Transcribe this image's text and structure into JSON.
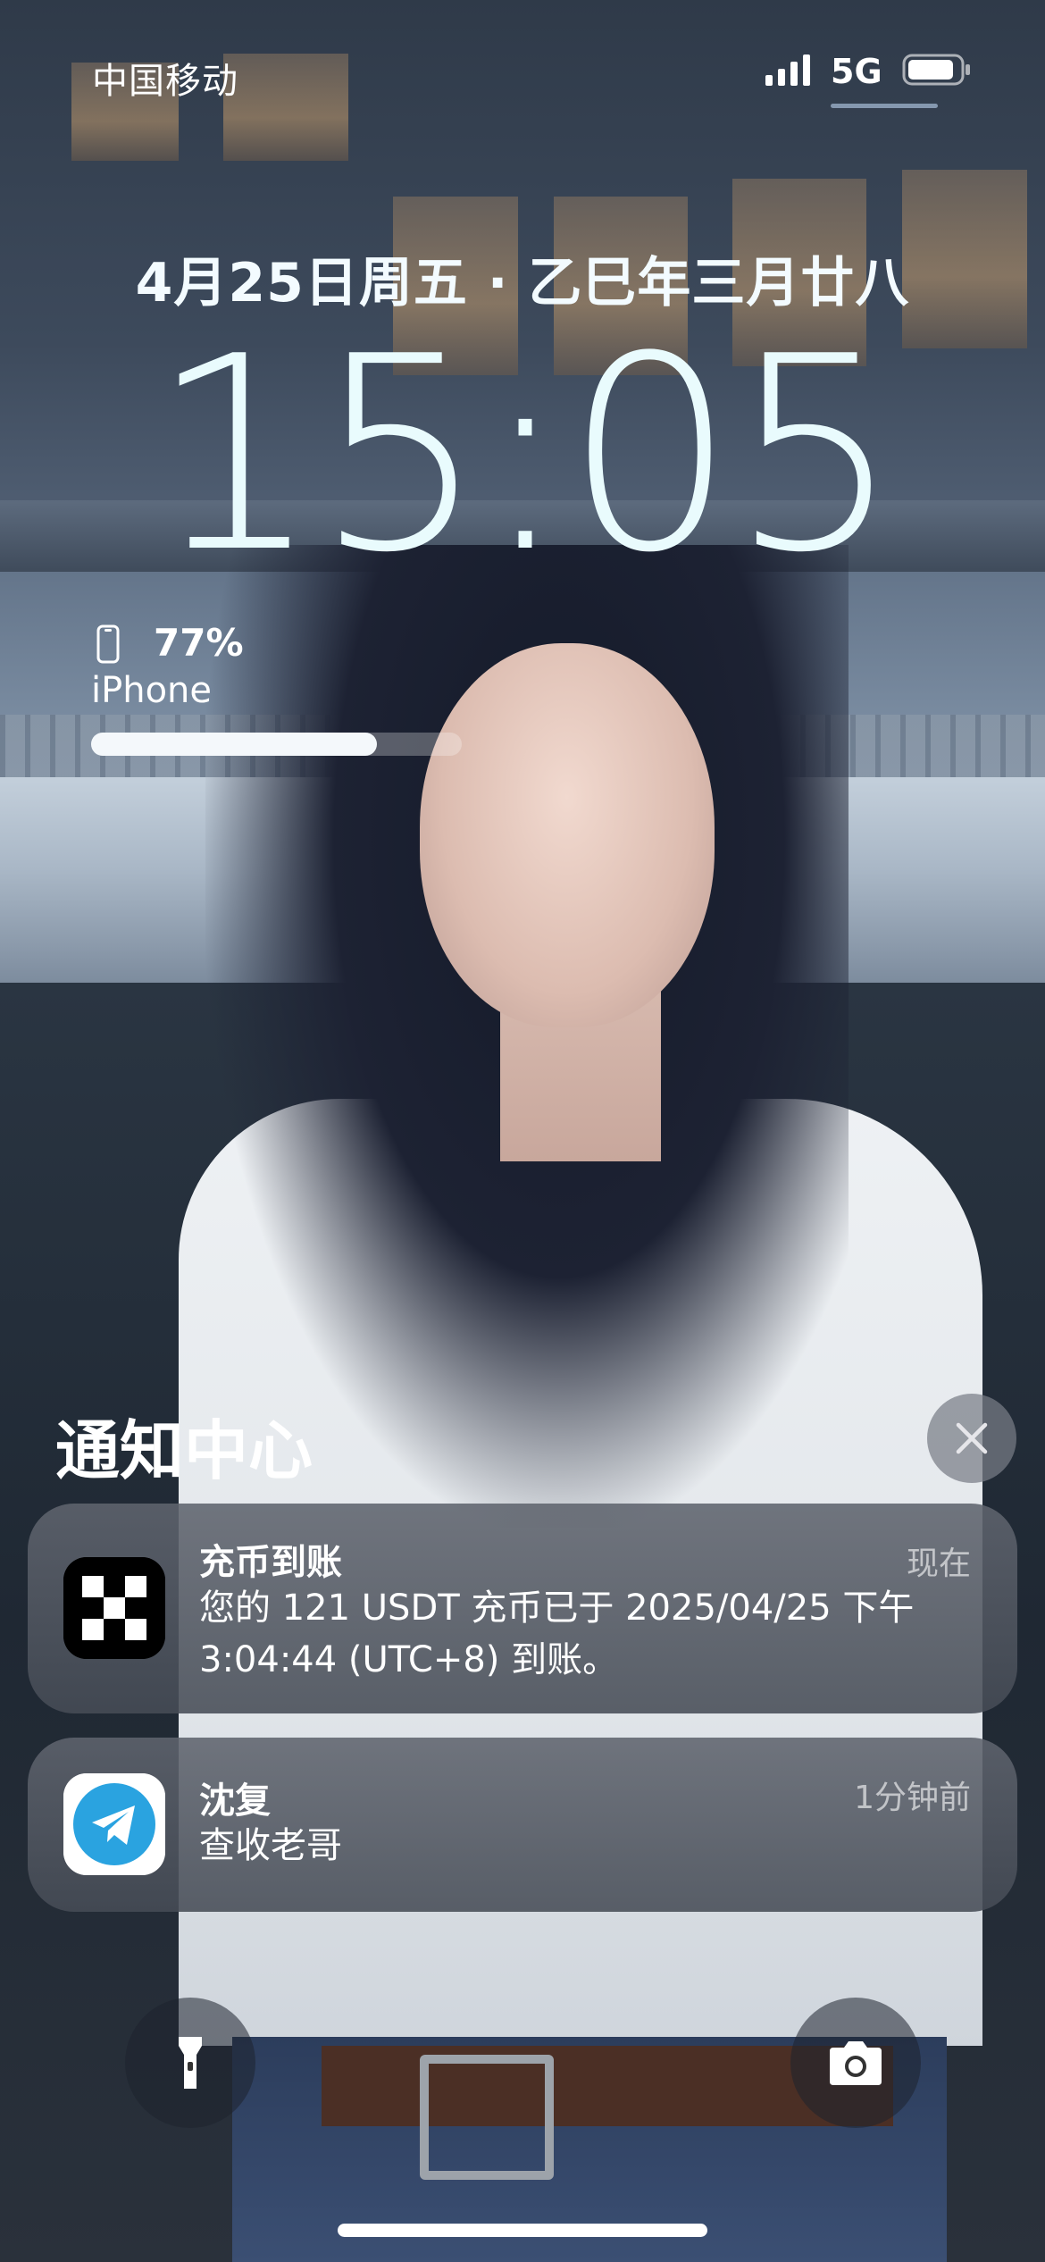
{
  "status_bar": {
    "carrier": "中国移动",
    "network": "5G",
    "signal_icon": "signal-bars-icon",
    "battery_icon": "battery-icon"
  },
  "lock_screen": {
    "date": "4月25日周五 · 乙巳年三月廿八",
    "time": "15:05"
  },
  "battery_widget": {
    "percent_label": "77%",
    "percent_value": 0.77,
    "device": "iPhone",
    "icon": "phone-icon"
  },
  "notification_center": {
    "title": "通知中心",
    "clear_icon": "close-icon",
    "notifications": [
      {
        "app_icon": "exchange-app-icon",
        "title": "充币到账",
        "time": "现在",
        "body": "您的 121 USDT 充币已于 2025/04/25 下午 3:04:44 (UTC+8) 到账。"
      },
      {
        "app_icon": "telegram-icon",
        "title": "沈复",
        "time": "1分钟前",
        "body": "查收老哥"
      }
    ]
  },
  "quick_actions": {
    "left_icon": "flashlight-icon",
    "right_icon": "camera-icon"
  },
  "colors": {
    "clock": "#e9fbfd",
    "notification_bg": "#5f646e",
    "telegram_blue": "#2aa3e0"
  }
}
